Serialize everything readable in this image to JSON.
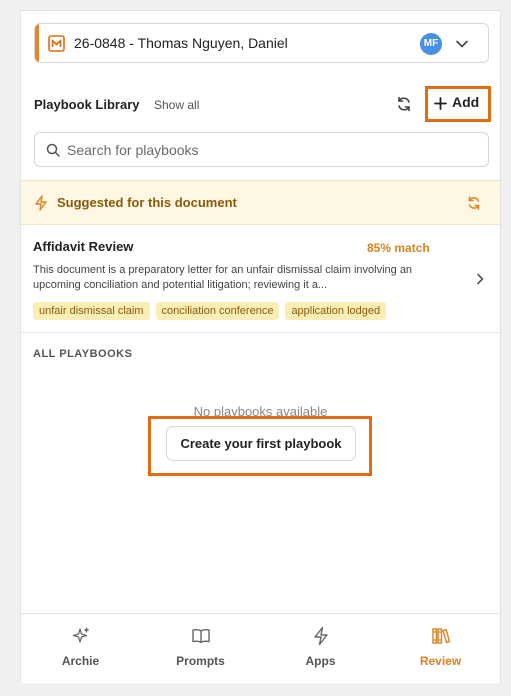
{
  "matter": {
    "label": "26-0848 - Thomas Nguyen, Daniel",
    "avatar_initials": "MF",
    "accent_color": "#e8842a",
    "avatar_color": "#4a90e2"
  },
  "library": {
    "title": "Playbook Library",
    "show_all": "Show all",
    "add_label": "Add"
  },
  "search": {
    "placeholder": "Search for playbooks",
    "value": ""
  },
  "suggested": {
    "title": "Suggested for this document",
    "card": {
      "title": "Affidavit Review",
      "match": "85% match",
      "description": "This document is a preparatory letter for an unfair dismissal claim involving an upcoming conciliation and potential litigation; reviewing it a...",
      "tags": [
        "unfair dismissal claim",
        "conciliation conference",
        "application lodged"
      ]
    }
  },
  "all_playbooks": {
    "title": "ALL PLAYBOOKS",
    "empty_text": "No playbooks available",
    "create_label": "Create your first playbook"
  },
  "nav": {
    "items": [
      {
        "label": "Archie",
        "icon": "sparkle-icon",
        "active": false
      },
      {
        "label": "Prompts",
        "icon": "book-icon",
        "active": false
      },
      {
        "label": "Apps",
        "icon": "bolt-icon",
        "active": false
      },
      {
        "label": "Review",
        "icon": "library-icon",
        "active": true
      }
    ],
    "active_color": "#e08122"
  }
}
